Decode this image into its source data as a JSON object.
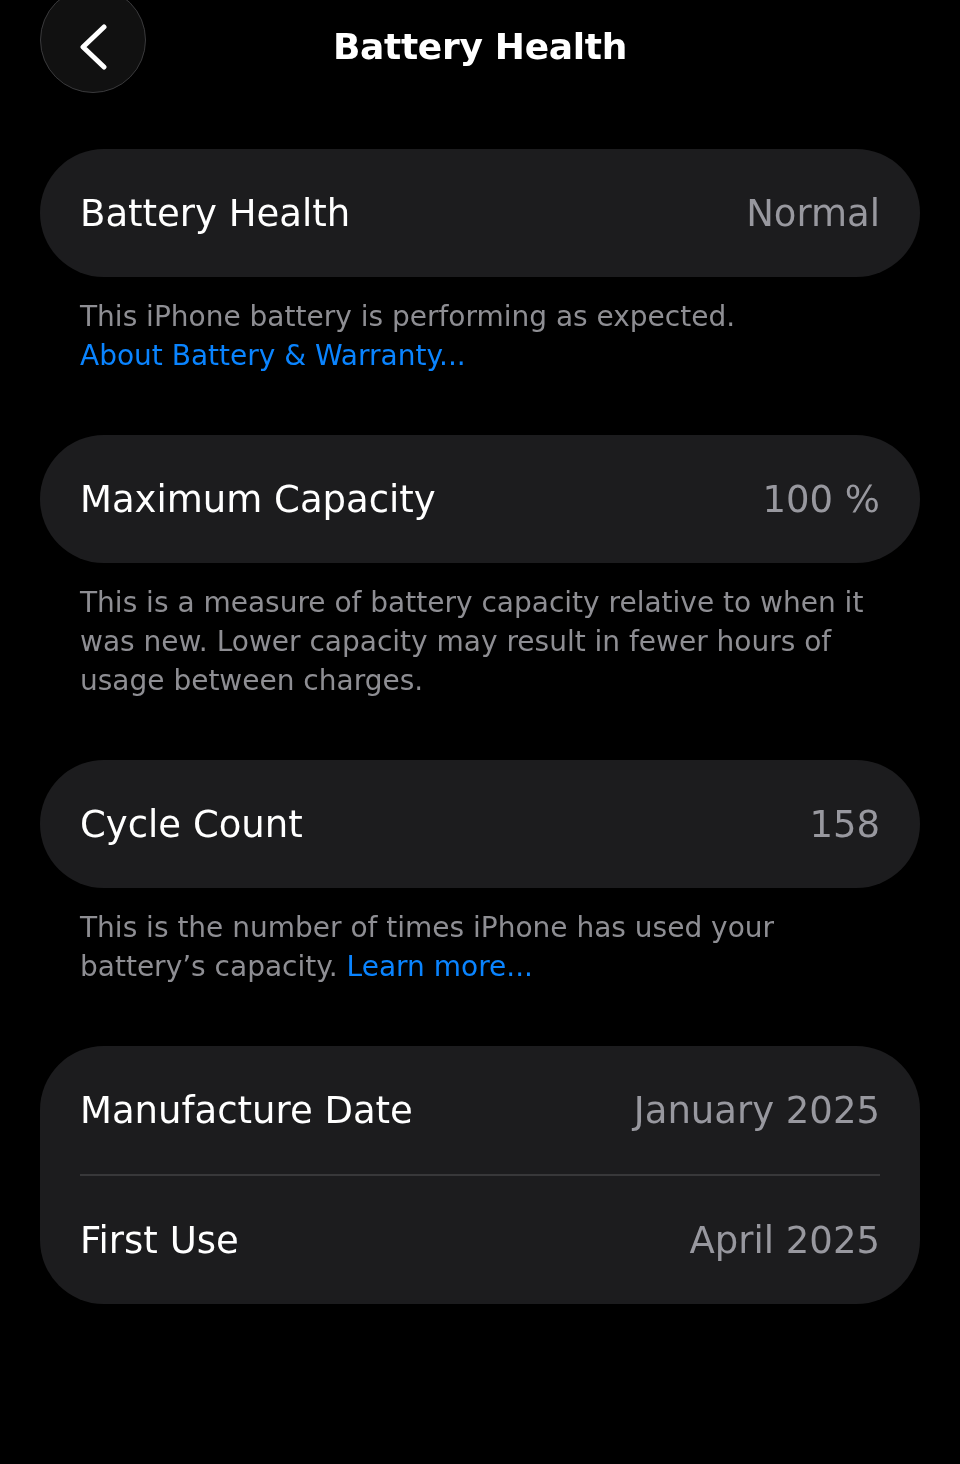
{
  "header": {
    "title": "Battery Health"
  },
  "sections": [
    {
      "rows": [
        {
          "label": "Battery Health",
          "value": "Normal"
        }
      ],
      "footer": {
        "text": "This iPhone battery is performing as expected.",
        "link": "About Battery & Warranty..."
      }
    },
    {
      "rows": [
        {
          "label": "Maximum Capacity",
          "value": "100 %"
        }
      ],
      "footer": {
        "text": "This is a measure of battery capacity relative to when it was new. Lower capacity may result in fewer hours of usage between charges."
      }
    },
    {
      "rows": [
        {
          "label": "Cycle Count",
          "value": "158"
        }
      ],
      "footer": {
        "text": "This is the number of times iPhone has used your battery’s capacity.",
        "link": "Learn more..."
      }
    },
    {
      "rows": [
        {
          "label": "Manufacture Date",
          "value": "January 2025"
        },
        {
          "label": "First Use",
          "value": "April 2025"
        }
      ]
    }
  ]
}
